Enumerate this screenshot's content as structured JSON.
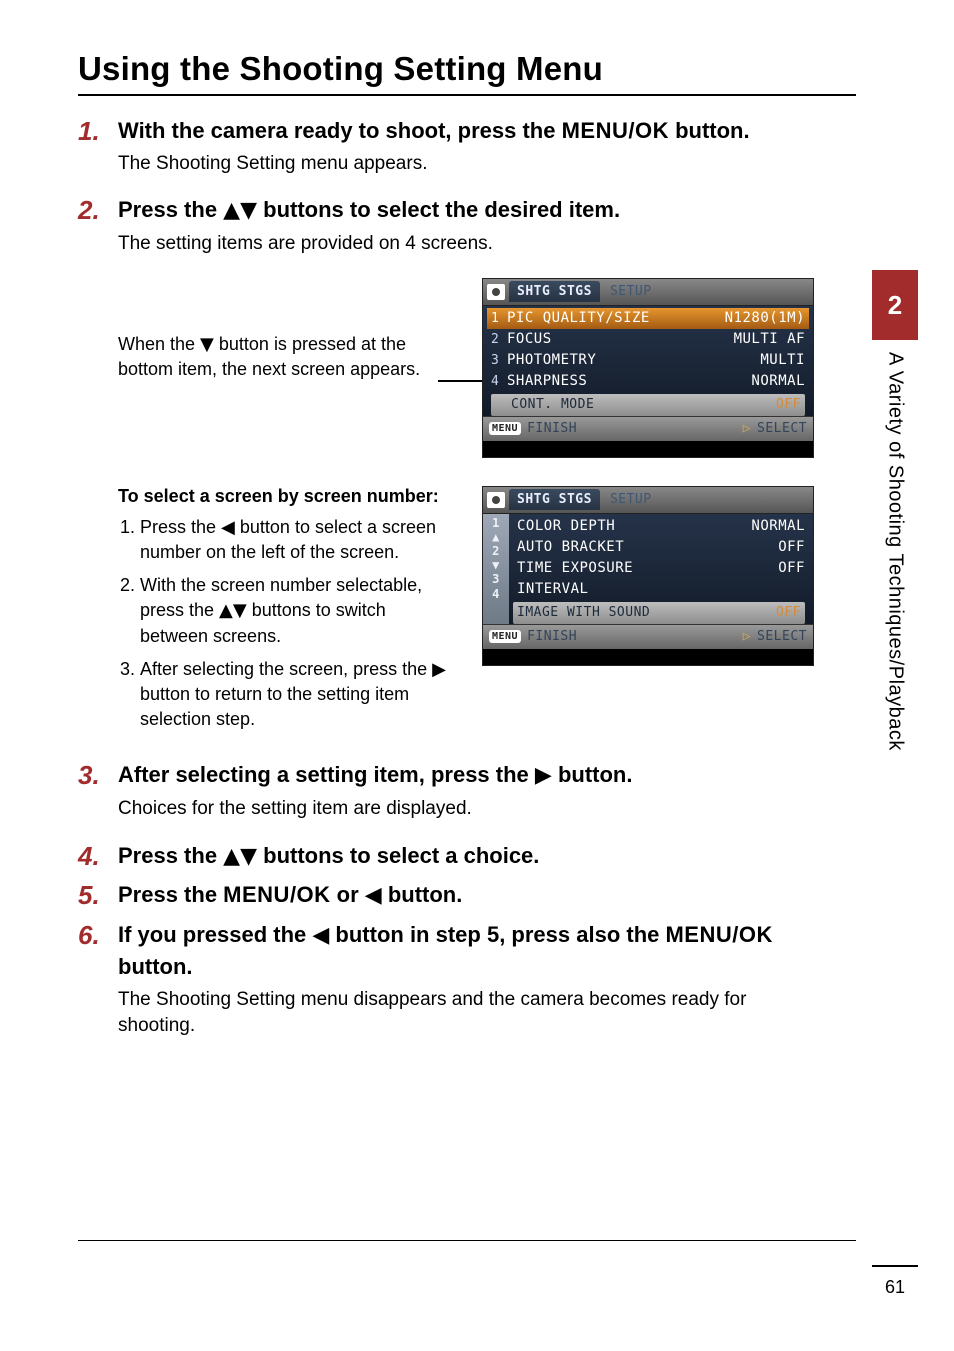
{
  "title": "Using the Shooting Setting Menu",
  "side": {
    "chapter": "2",
    "label": "A Variety of Shooting Techniques/Playback"
  },
  "page_number": "61",
  "steps": {
    "s1": {
      "num": "1.",
      "title_a": "With the camera ready to shoot, press the ",
      "title_b": "MENU/OK",
      "title_c": " button.",
      "sub": "The Shooting Setting menu appears."
    },
    "s2": {
      "num": "2.",
      "title_a": "Press the ",
      "title_b": "▲▼",
      "title_c": " buttons to select the desired item.",
      "sub": "The setting items are provided on 4 screens."
    },
    "callout": {
      "a": "When the ",
      "b": "▼",
      "c": " button is pressed at the bottom item, the next screen appears."
    },
    "sub_section": {
      "heading": "To select a screen by screen number:",
      "i1a": "Press the ",
      "i1b": "◀",
      "i1c": " button to select a screen number on the left of the screen.",
      "i2a": "With the screen number selectable, press the ",
      "i2b": "▲▼",
      "i2c": " buttons to switch between screens.",
      "i3a": "After selecting the screen, press the ",
      "i3b": "▶",
      "i3c": " button to return to the setting item selection step."
    },
    "s3": {
      "num": "3.",
      "title_a": "After selecting a setting item, press the ",
      "title_b": "▶",
      "title_c": " button.",
      "sub": "Choices for the setting item are displayed."
    },
    "s4": {
      "num": "4.",
      "title_a": "Press the ",
      "title_b": "▲▼",
      "title_c": " buttons to select a choice."
    },
    "s5": {
      "num": "5.",
      "title_a": "Press the ",
      "title_b": "MENU/OK",
      "title_c": " or ",
      "title_d": "◀",
      "title_e": " button."
    },
    "s6": {
      "num": "6.",
      "title_a": "If you pressed the ",
      "title_b": "◀",
      "title_c": " button in step 5, press also the ",
      "title_d": "MENU/OK",
      "title_e": " button.",
      "sub": "The Shooting Setting menu disappears and the camera becomes ready for shooting."
    }
  },
  "screenshot1": {
    "tab1": "SHTG STGS",
    "tab2": "SETUP",
    "rows": [
      {
        "n": "1",
        "label": "PIC QUALITY/SIZE",
        "val": "N1280(1M)",
        "hl": true
      },
      {
        "n": "2",
        "label": "FOCUS",
        "val": "MULTI AF"
      },
      {
        "n": "3",
        "label": "PHOTOMETRY",
        "val": "MULTI"
      },
      {
        "n": "4",
        "label": "SHARPNESS",
        "val": "NORMAL"
      }
    ],
    "gray_row": {
      "label": "CONT. MODE",
      "val": "OFF"
    },
    "foot_menu": "MENU",
    "foot_finish": "FINISH",
    "foot_select": "SELECT"
  },
  "screenshot2": {
    "tab1": "SHTG STGS",
    "tab2": "SETUP",
    "side_nums": [
      "1",
      "2",
      "3",
      "4"
    ],
    "rows": [
      {
        "label": "COLOR DEPTH",
        "val": "NORMAL"
      },
      {
        "label": "AUTO BRACKET",
        "val": "OFF"
      },
      {
        "label": "TIME EXPOSURE",
        "val": "OFF"
      },
      {
        "label": "INTERVAL",
        "val": ""
      }
    ],
    "gray_row": {
      "label": "IMAGE WITH SOUND",
      "val": "OFF"
    },
    "foot_menu": "MENU",
    "foot_finish": "FINISH",
    "foot_select": "SELECT"
  }
}
